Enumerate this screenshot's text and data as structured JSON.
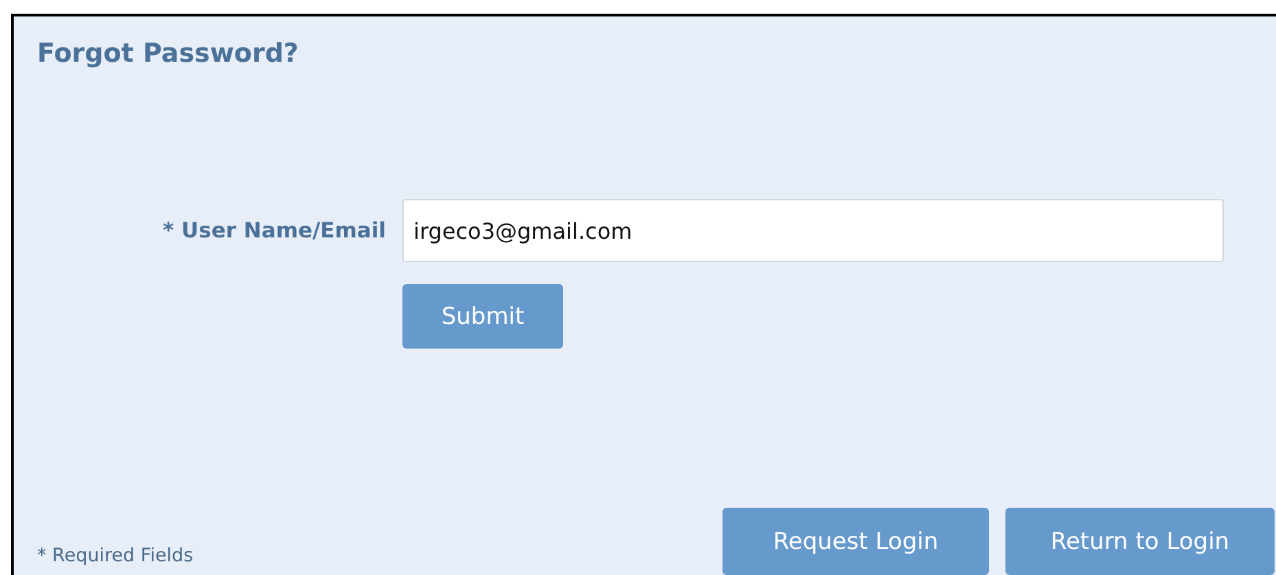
{
  "title": "Forgot Password?",
  "field": {
    "label": "* User Name/Email",
    "value": "irgeco3@gmail.com"
  },
  "submit_button": "Submit",
  "footnote": "* Required Fields",
  "buttons": [
    "Request Login",
    "Return to Login"
  ]
}
